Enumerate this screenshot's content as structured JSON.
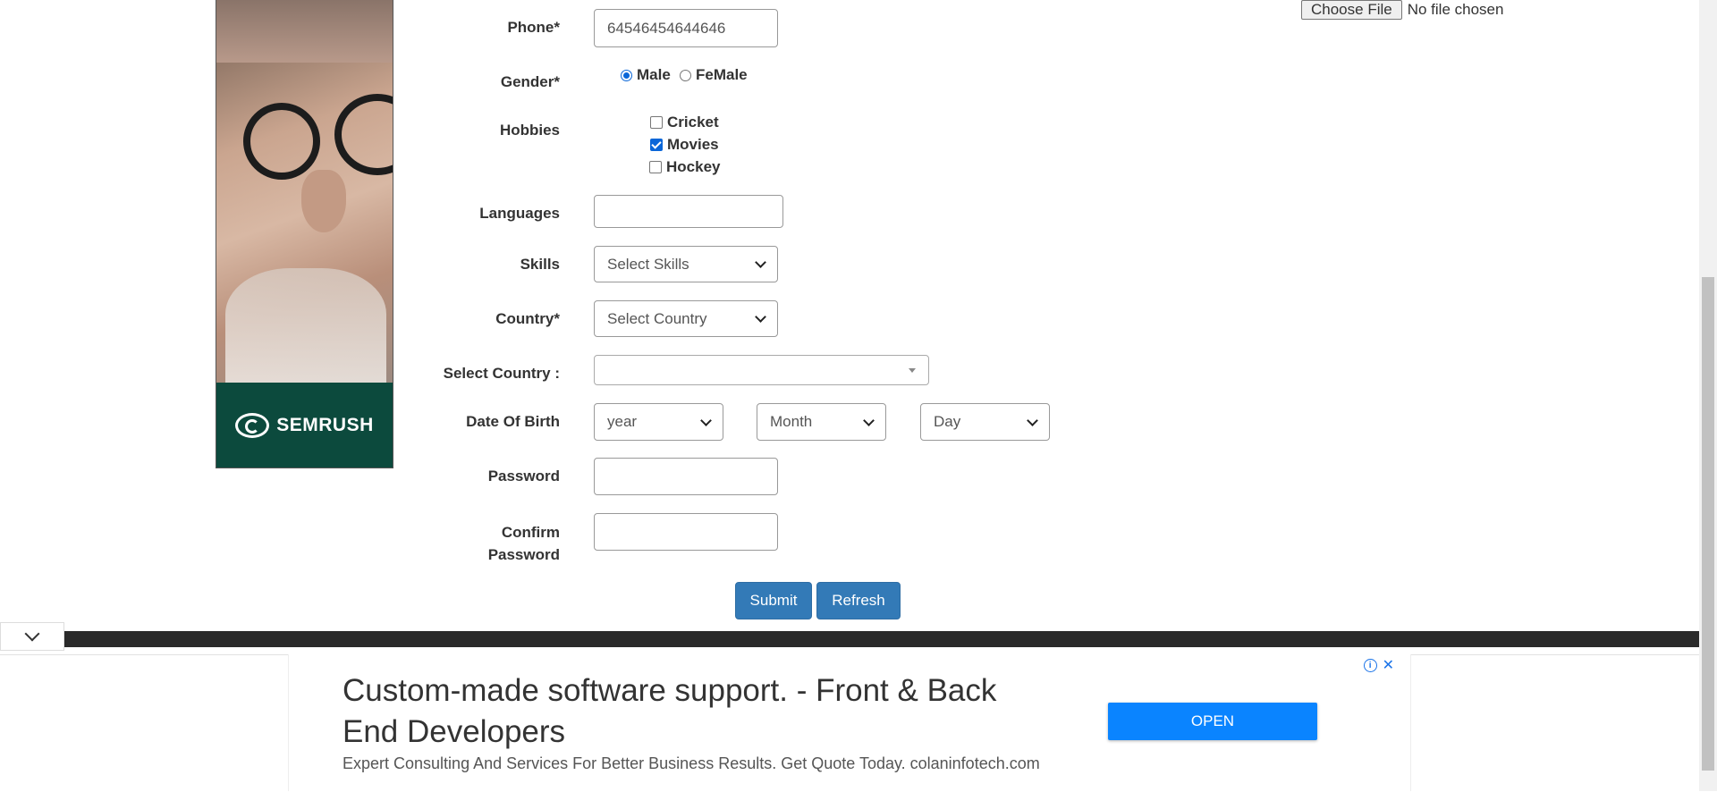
{
  "ad_left": {
    "brand": "SEMRUSH"
  },
  "file_upload": {
    "button": "Choose File",
    "status": "No file chosen"
  },
  "form": {
    "phone": {
      "label": "Phone*",
      "value": "64546454644646"
    },
    "gender": {
      "label": "Gender*",
      "options": [
        "Male",
        "FeMale"
      ],
      "selected": "Male"
    },
    "hobbies": {
      "label": "Hobbies",
      "options": [
        {
          "label": "Cricket",
          "checked": false
        },
        {
          "label": "Movies",
          "checked": true
        },
        {
          "label": "Hockey",
          "checked": false
        }
      ]
    },
    "languages": {
      "label": "Languages",
      "value": ""
    },
    "skills": {
      "label": "Skills",
      "selected": "Select Skills"
    },
    "country": {
      "label": "Country*",
      "selected": "Select Country"
    },
    "select_country": {
      "label": "Select Country :",
      "value": ""
    },
    "dob": {
      "label": "Date Of Birth",
      "year": "year",
      "month": "Month",
      "day": "Day"
    },
    "password": {
      "label": "Password",
      "value": ""
    },
    "confirm_password": {
      "label_line1": "Confirm",
      "label_line2": "Password",
      "value": ""
    },
    "buttons": {
      "submit": "Submit",
      "refresh": "Refresh"
    }
  },
  "bottom_ad": {
    "title": "Custom-made software support. - Front & Back End Developers",
    "description": "Expert Consulting And Services For Better Business Results. Get Quote Today. colaninfotech.com",
    "cta": "OPEN",
    "info_icon": "info-icon",
    "close_icon": "close-icon"
  }
}
